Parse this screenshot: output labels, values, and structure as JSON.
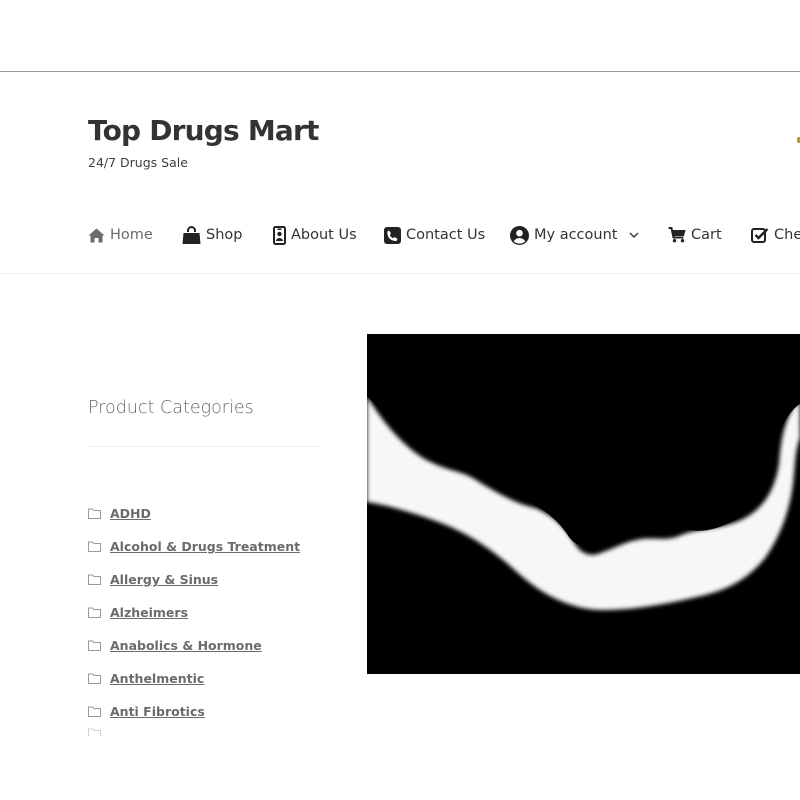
{
  "site": {
    "title": "Top Drugs Mart",
    "tagline": "24/7 Drugs Sale"
  },
  "nav": {
    "items": [
      {
        "label": "Home",
        "icon": "home-icon",
        "active": true
      },
      {
        "label": "Shop",
        "icon": "shopping-bag-icon"
      },
      {
        "label": "About Us",
        "icon": "id-badge-icon"
      },
      {
        "label": "Contact Us",
        "icon": "phone-square-icon"
      },
      {
        "label": "My account",
        "icon": "user-circle-icon",
        "has_dropdown": true
      },
      {
        "label": "Cart",
        "icon": "cart-icon"
      },
      {
        "label": "Che",
        "icon": "check-square-icon"
      }
    ]
  },
  "sidebar": {
    "widget_title": "Product Categories",
    "categories": [
      "ADHD",
      "Alcohol & Drugs Treatment",
      "Allergy & Sinus",
      "Alzheimers",
      "Anabolics & Hormone",
      "Anthelmentic",
      "Anti Fibrotics"
    ]
  },
  "hero": {
    "image_description": "black-and-white silhouette of two faces about to kiss"
  },
  "colors": {
    "text": "#333333",
    "muted": "#6b6b6b",
    "divider": "#ececec",
    "topbar_border": "#9a9a9a"
  }
}
